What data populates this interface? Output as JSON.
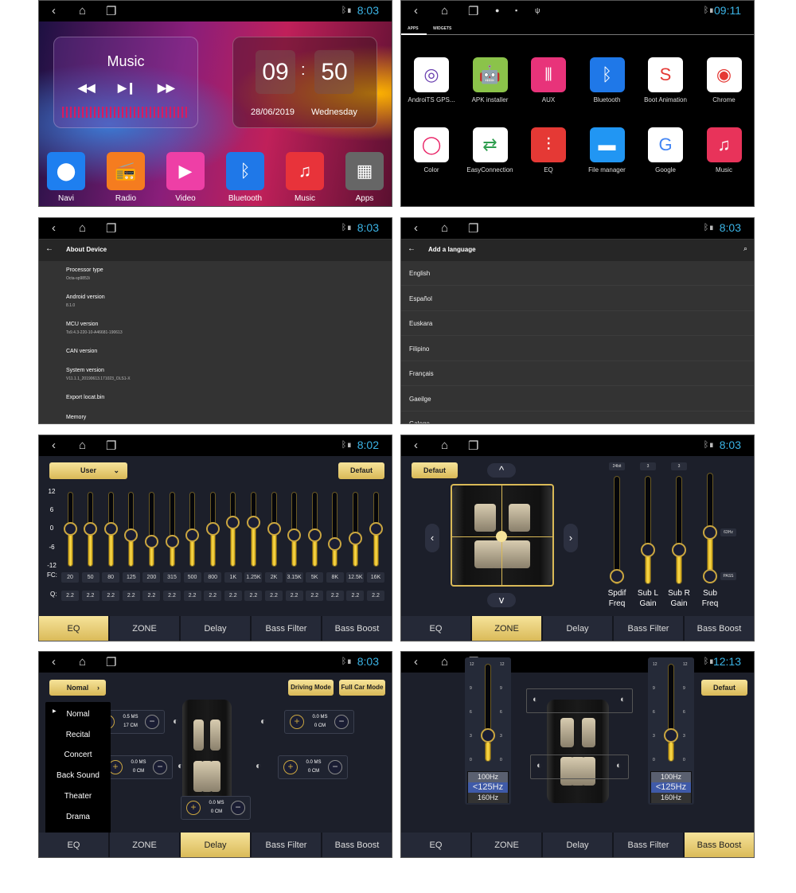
{
  "status_bars": [
    {
      "time": "8:03"
    },
    {
      "time": "09:11"
    },
    {
      "time": "8:03"
    },
    {
      "time": "8:03"
    },
    {
      "time": "8:02"
    },
    {
      "time": "8:03"
    },
    {
      "time": "8:03"
    },
    {
      "time": "12:13"
    }
  ],
  "home": {
    "music_title": "Music",
    "clock_hour": "09",
    "clock_sep": ":",
    "clock_min": "50",
    "date": "28/06/2019",
    "day": "Wednesday",
    "apps": [
      {
        "label": "Navi",
        "color": "#1e7ff0",
        "icon": "map-pin-icon",
        "glyph": "⬤"
      },
      {
        "label": "Radio",
        "color": "#f57c1f",
        "icon": "radio-icon",
        "glyph": "📻"
      },
      {
        "label": "Video",
        "color": "#ee3fa6",
        "icon": "video-icon",
        "glyph": "▶"
      },
      {
        "label": "Bluetooth",
        "color": "#1f78e8",
        "icon": "bluetooth-icon",
        "glyph": "ᛒ"
      },
      {
        "label": "Music",
        "color": "#e8333a",
        "icon": "music-note-icon",
        "glyph": "♫"
      },
      {
        "label": "Apps",
        "color": "#666666",
        "icon": "apps-grid-icon",
        "glyph": "▦"
      }
    ]
  },
  "drawer": {
    "tabs": [
      "APPS",
      "WIDGETS"
    ],
    "apps": [
      {
        "label": "AndroiTS GPS...",
        "color": "#ffffff",
        "icon": "gps-icon",
        "glyph": "◎",
        "fg": "#6a3fb0"
      },
      {
        "label": "APK installer",
        "color": "#8bc34a",
        "icon": "android-icon",
        "glyph": "🤖",
        "fg": "#fff"
      },
      {
        "label": "AUX",
        "color": "#e8337a",
        "icon": "aux-icon",
        "glyph": "⫴",
        "fg": "#fff"
      },
      {
        "label": "Bluetooth",
        "color": "#1f78e8",
        "icon": "bluetooth-icon",
        "glyph": "ᛒ",
        "fg": "#fff"
      },
      {
        "label": "Boot Animation",
        "color": "#ffffff",
        "icon": "boot-animation-icon",
        "glyph": "S",
        "fg": "#e53935"
      },
      {
        "label": "Chrome",
        "color": "#ffffff",
        "icon": "chrome-icon",
        "glyph": "◉",
        "fg": "#e53935"
      },
      {
        "label": "Color",
        "color": "#ffffff",
        "icon": "color-wheel-icon",
        "glyph": "◯",
        "fg": "#e91e63"
      },
      {
        "label": "EasyConnection",
        "color": "#ffffff",
        "icon": "easy-connection-icon",
        "glyph": "⇄",
        "fg": "#2e9e4e"
      },
      {
        "label": "EQ",
        "color": "#e53935",
        "icon": "equalizer-icon",
        "glyph": "⫶",
        "fg": "#fff"
      },
      {
        "label": "File manager",
        "color": "#2196f3",
        "icon": "folder-icon",
        "glyph": "▬",
        "fg": "#fff"
      },
      {
        "label": "Google",
        "color": "#ffffff",
        "icon": "google-icon",
        "glyph": "G",
        "fg": "#4285f4"
      },
      {
        "label": "Music",
        "color": "#e8335a",
        "icon": "music-note-icon",
        "glyph": "♫",
        "fg": "#fff"
      }
    ]
  },
  "about": {
    "title": "About Device",
    "items": [
      {
        "label": "Processor type",
        "value": "Octa-sp9853i"
      },
      {
        "label": "Android version",
        "value": "8.1.0"
      },
      {
        "label": "MCU version",
        "value": "Ts9.4.3-220-10-A46681-190613"
      },
      {
        "label": "CAN version",
        "value": ""
      },
      {
        "label": "System version",
        "value": "V11.1.1_20190613.171023_OLS1-X"
      },
      {
        "label": "Export locat.bin",
        "value": ""
      },
      {
        "label": "Memory",
        "value": ""
      }
    ]
  },
  "language": {
    "title": "Add a language",
    "items": [
      "English",
      "Español",
      "Euskara",
      "Filipino",
      "Français",
      "Gaeilge",
      "Galego"
    ]
  },
  "audio_tabs": [
    "EQ",
    "ZONE",
    "Delay",
    "Bass Filter",
    "Bass Boost"
  ],
  "eq": {
    "preset": "User",
    "default_label": "Defaut",
    "y_ticks": [
      "12",
      "6",
      "0",
      "-6",
      "-12"
    ],
    "fc_label": "FC:",
    "q_label": "Q:",
    "bands": [
      {
        "fc": "20",
        "q": "2.2",
        "gain": 0
      },
      {
        "fc": "50",
        "q": "2.2",
        "gain": 0
      },
      {
        "fc": "80",
        "q": "2.2",
        "gain": 0
      },
      {
        "fc": "125",
        "q": "2.2",
        "gain": -2
      },
      {
        "fc": "200",
        "q": "2.2",
        "gain": -4
      },
      {
        "fc": "315",
        "q": "2.2",
        "gain": -4
      },
      {
        "fc": "500",
        "q": "2.2",
        "gain": -2
      },
      {
        "fc": "800",
        "q": "2.2",
        "gain": 0
      },
      {
        "fc": "1K",
        "q": "2.2",
        "gain": 2
      },
      {
        "fc": "1.25K",
        "q": "2.2",
        "gain": 2
      },
      {
        "fc": "2K",
        "q": "2.2",
        "gain": 0
      },
      {
        "fc": "3.15K",
        "q": "2.2",
        "gain": -2
      },
      {
        "fc": "5K",
        "q": "2.2",
        "gain": -2
      },
      {
        "fc": "8K",
        "q": "2.2",
        "gain": -5
      },
      {
        "fc": "12.5K",
        "q": "2.2",
        "gain": -3
      },
      {
        "fc": "16K",
        "q": "2.2",
        "gain": 0
      }
    ]
  },
  "zone": {
    "default_label": "Defaut",
    "sliders": [
      {
        "label1": "Spdif",
        "label2": "Freq",
        "badge": "24bit",
        "level": 0
      },
      {
        "label1": "Sub L",
        "label2": "Gain",
        "badge": "3",
        "level": 0.3
      },
      {
        "label1": "Sub R",
        "label2": "Gain",
        "badge": "3",
        "level": 0.3
      },
      {
        "label1": "Sub",
        "label2": "Freq",
        "low": "PASS",
        "high": "63Hz",
        "level": 0.45
      }
    ]
  },
  "delay": {
    "preset": "Nomal",
    "driving_mode": "Driving Mode",
    "full_car_mode": "Full Car Mode",
    "menu": [
      "Nomal",
      "Recital",
      "Concert",
      "Back Sound",
      "Theater",
      "Drama"
    ],
    "speakers": [
      {
        "ms": "0.5 MS",
        "cm": "17 CM"
      },
      {
        "ms": "0.0 MS",
        "cm": "0 CM"
      },
      {
        "ms": "0.0 MS",
        "cm": "0 CM"
      },
      {
        "ms": "0.0 MS",
        "cm": "0 CM"
      },
      {
        "ms": "0.0 MS",
        "cm": "0 CM"
      }
    ]
  },
  "bassboost": {
    "default_label": "Defaut",
    "ticks": [
      "12",
      "9",
      "6",
      "3",
      "0"
    ],
    "channels": [
      {
        "gain": 3,
        "freqs": [
          "100Hz",
          "<125Hz",
          "160Hz"
        ],
        "selected": "<125Hz"
      },
      {
        "gain": 3,
        "freqs": [
          "100Hz",
          "<125Hz",
          "160Hz"
        ],
        "selected": "<125Hz"
      }
    ]
  },
  "colors": {
    "accent_gold": "#e9cf74",
    "time_blue": "#3bb4e6",
    "panel_bg": "#1c1f2a",
    "selected_freq": "#3f5aa8"
  }
}
